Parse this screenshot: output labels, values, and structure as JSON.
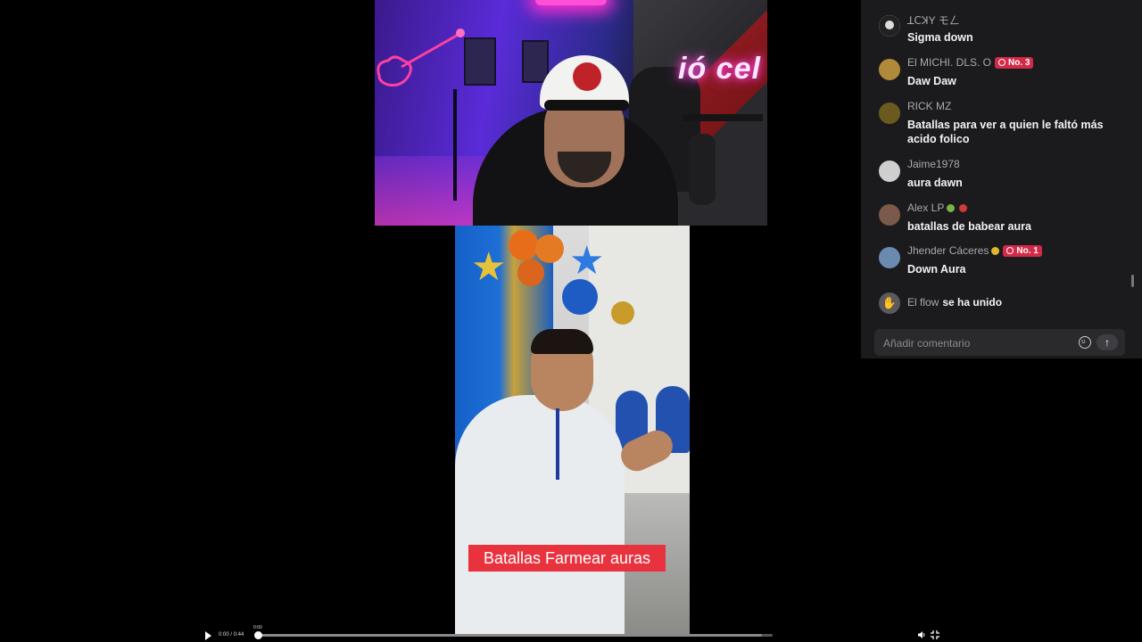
{
  "webcam": {
    "neon_sign": "ió cel"
  },
  "clip": {
    "caption": "Batallas Farmear auras"
  },
  "player": {
    "current_time": "0:00 / 0:44",
    "hover_time": "0:00",
    "progress_fraction": 0.0,
    "buffered_fraction": 0.98,
    "icons": {
      "play": "play-icon",
      "volume": "volume-icon",
      "fullscreen": "exit-fullscreen-icon"
    }
  },
  "chat": {
    "messages": [
      {
        "user": "ꓕꓚꓘY モㄥ",
        "text": "Sigma down",
        "avatar_color": "#d8d8d8"
      },
      {
        "user": "El MICHI. DLS. O",
        "badge": "No. 3",
        "text": "Daw Daw",
        "avatar_color": "#b08a3a"
      },
      {
        "user": "RICK MZ",
        "text": "Batallas para ver a quien le faltó más acido folico",
        "avatar_color": "#6a5a20"
      },
      {
        "user": "Jaime1978",
        "text": "aura dawn",
        "avatar_color": "#cfcfcf"
      },
      {
        "user": "Alex LP",
        "text": "batallas de babear aura",
        "avatar_color": "#7a5a4a"
      },
      {
        "user": "Jhender Cáceres",
        "badge": "No. 1",
        "text": "Down Aura",
        "avatar_color": "#6a8ab0"
      }
    ],
    "join_event": {
      "user": "El flow",
      "action": "se ha unido"
    },
    "comment_placeholder": "Añadir comentario",
    "send_label": "↑",
    "colors": {
      "background": "#1b1b1d",
      "badge": "#d22a47"
    }
  }
}
